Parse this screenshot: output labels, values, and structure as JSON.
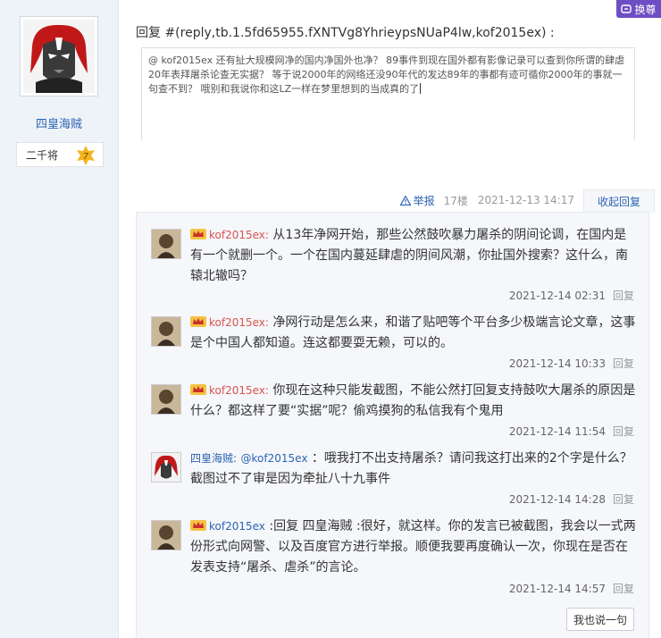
{
  "user": {
    "name": "四皇海贼",
    "level_title": "二千将",
    "level_number": "7"
  },
  "header": {
    "switch_label": "换尊",
    "reply_title": "回复 #(reply,tb.1.5fd65955.fXNTVg8YhrieypsNUaP4lw,kof2015ex) :"
  },
  "reply_box": {
    "value": "@ kof2015ex 还有扯大规模网净的国内净国外也净？ 89事件到现在国外都有影像记录可以查到你所谓的肆虐20年表拜屠杀论查无实据？ 等于说2000年的网络还没90年代的发达89年的事都有迹可循你2000年的事就一句查不到？ 哦别和我说你和这LZ一样在梦里想到的当成真的了"
  },
  "post_meta": {
    "report_label": "举报",
    "floor": "17楼",
    "time": "2021-12-13 14:17",
    "collapse_label": "收起回复"
  },
  "sub_replies": [
    {
      "author": "kof2015ex",
      "author_color": "red",
      "text": "从13年净网开始，那些公然鼓吹暴力屠杀的阴间论调，在国内是有一个就删一个。一个在国内蔓延肆虐的阴间风潮，你扯国外搜索？这什么，南辕北辙吗？",
      "time": "2021-12-14 02:31",
      "reply_label": "回复"
    },
    {
      "author": "kof2015ex",
      "author_color": "red",
      "text": "净网行动是怎么来，和谐了贴吧等个平台多少极端言论文章，这事是个中国人都知道。连这都要耍无赖，可以的。",
      "time": "2021-12-14 10:33",
      "reply_label": "回复"
    },
    {
      "author": "kof2015ex",
      "author_color": "red",
      "text": "你现在这种只能发截图，不能公然打回复支持鼓吹大屠杀的原因是什么？都这样了要“实据”呢？偷鸡摸狗的私信我有个鬼用",
      "time": "2021-12-14 11:54",
      "reply_label": "回复"
    },
    {
      "author": "四皇海贼",
      "author_color": "blue",
      "mention": "@kof2015ex",
      "text": "：哦我打不出支持屠杀？请问我这打出来的2个字是什么？截图过不了审是因为牵扯八十九事件",
      "time": "2021-12-14 14:28",
      "reply_label": "回复"
    },
    {
      "author": "kof2015ex",
      "author_color": "blue",
      "reply_prefix": ":回复",
      "reply_target": "四皇海贼",
      "text": ":很好，就这样。你的发言已被截图，我会以一式两份形式向网警、以及百度官方进行举报。顺便我要再度确认一次，你现在是否在发表支持“屠杀、虐杀”的言论。",
      "time": "2021-12-14 14:57",
      "reply_label": "回复"
    }
  ],
  "i_say_label": "我也说一句",
  "colors": {
    "accent_blue": "#2d64b3",
    "name_red": "#d9534f",
    "switch_purple": "#6e4ec3",
    "sidebar_bg": "#eef3f8"
  }
}
